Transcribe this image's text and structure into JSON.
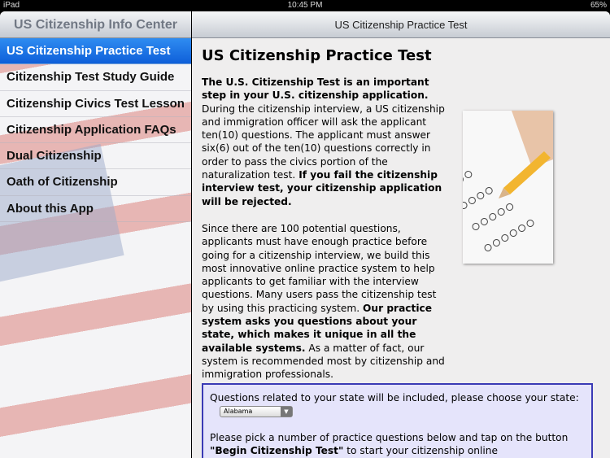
{
  "status": {
    "device": "iPad",
    "time": "10:45 PM",
    "battery": "65%"
  },
  "sidebar": {
    "title": "US Citizenship Info Center",
    "items": [
      {
        "label": "US Citizenship Practice Test",
        "selected": true
      },
      {
        "label": "Citizenship Test Study Guide"
      },
      {
        "label": "Citizenship Civics Test Lesson"
      },
      {
        "label": "Citizenship Application FAQs"
      },
      {
        "label": "Dual Citizenship"
      },
      {
        "label": "Oath of Citizenship"
      },
      {
        "label": "About this App"
      }
    ]
  },
  "main": {
    "nav_title": "US Citizenship Practice Test",
    "heading": "US Citizenship Practice Test",
    "p1": {
      "b1": "The U.S. Citizenship Test is an important step in your U.S. citizenship application.",
      "t1": " During the citizenship interview, a US citizenship and immigration officer will ask the applicant ten(10) questions. The applicant must answer six(6) out of the ten(10) questions correctly in order to pass the civics portion of the naturalization test. ",
      "b2": "If you fail the citizenship interview test, your citizenship application will be rejected."
    },
    "p2": {
      "t1": "Since there are 100 potential questions, applicants must have enough practice before going for a citizenship interview, we build this most innovative online practice system to help applicants to get familiar with the interview questions. Many users pass the citizenship test by using this practicing system. ",
      "b1": "Our practice system asks you questions about your state, which makes it unique in all the available systems.",
      "t2": " As a matter of fact, our system is recommended most by citizenship and immigration professionals."
    },
    "box": {
      "state_prompt": "Questions related to your state will be included, please choose your state:",
      "state_value": "Alabama",
      "t1": "Please pick a number of practice questions below and tap on the button ",
      "b1": "\"Begin Citizenship Test\"",
      "t2": " to start your citizenship online"
    }
  }
}
